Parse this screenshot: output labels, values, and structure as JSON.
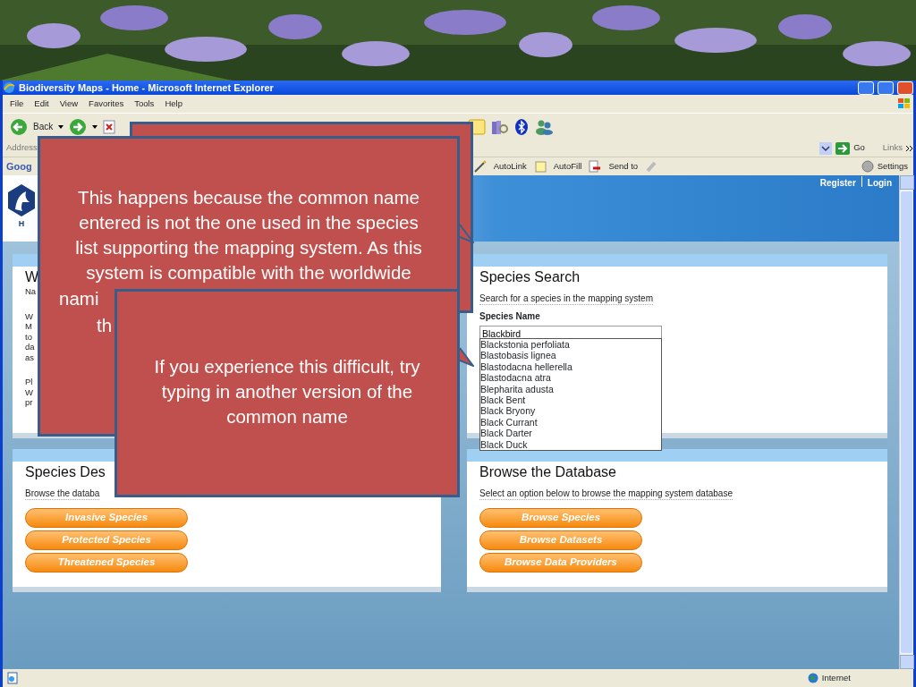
{
  "window": {
    "title": "Biodiversity Maps - Home - Microsoft Internet Explorer"
  },
  "menu": [
    "File",
    "Edit",
    "View",
    "Favorites",
    "Tools",
    "Help"
  ],
  "toolbar": {
    "back": "Back"
  },
  "address_bar": {
    "label": "Address",
    "go": "Go",
    "links": "Links"
  },
  "google_bar": {
    "logo": "Goog",
    "items": [
      "AutoLink",
      "AutoFill",
      "Send to"
    ],
    "settings": "Settings"
  },
  "site": {
    "header_links": [
      "Register",
      "Login"
    ],
    "logo_text": "H"
  },
  "welcome_panel": {
    "title": "W",
    "subtitle": "Na",
    "lines": [
      "W",
      "M",
      "to",
      "da",
      "as"
    ],
    "lines2": [
      "Pl",
      "W",
      "pr"
    ]
  },
  "species_search": {
    "title": "Species Search",
    "subtitle": "Search for a species in the mapping system",
    "label": "Species Name",
    "value": "Blackbird",
    "suggestions": [
      "Blackstonia perfoliata",
      "Blastobasis lignea",
      "Blastodacna hellerella",
      "Blastodacna atra",
      "Blepharita adusta",
      "Black Bent",
      "Black Bryony",
      "Black Currant",
      "Black Darter",
      "Black Duck"
    ]
  },
  "species_designations": {
    "title": "Species Des",
    "subtitle": "Browse the databa",
    "buttons": [
      "Invasive Species",
      "Protected Species",
      "Threatened Species"
    ]
  },
  "browse_database": {
    "title": "Browse the Database",
    "subtitle": "Select an option below to browse the mapping system database",
    "buttons": [
      "Browse Species",
      "Browse Datasets",
      "Browse Data Providers"
    ]
  },
  "status_bar": {
    "zone": "Internet"
  },
  "callouts": [
    {
      "lines": [
        "This happens because the common name",
        "entered is not the one used in the species",
        "list supporting the mapping system. As this",
        "system is compatible with the worldwide"
      ],
      "covered_lines": [
        "nami",
        "th"
      ]
    },
    {
      "lines": [
        "If you experience this difficult, try",
        "typing in another version of the",
        "common name"
      ]
    }
  ]
}
